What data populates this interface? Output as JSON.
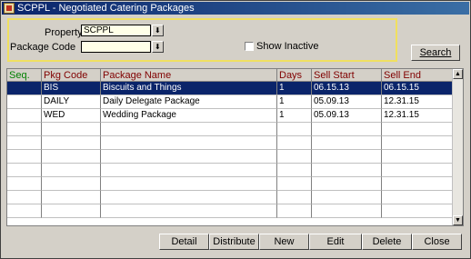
{
  "window": {
    "title": "SCPPL - Negotiated Catering Packages"
  },
  "filters": {
    "property_label": "Property",
    "property_value": "SCPPL",
    "package_code_label": "Package Code",
    "package_code_value": "",
    "show_inactive_label": "Show Inactive",
    "show_inactive_checked": false,
    "search_label": "Search"
  },
  "table": {
    "columns": [
      "Seq.",
      "Pkg Code",
      "Package Name",
      "Days",
      "Sell Start",
      "Sell End"
    ],
    "rows": [
      {
        "seq": "",
        "code": "BIS",
        "name": "Biscuits and Things",
        "days": "1",
        "start": "06.15.13",
        "end": "06.15.15",
        "selected": true
      },
      {
        "seq": "",
        "code": "DAILY",
        "name": "Daily Delegate Package",
        "days": "1",
        "start": "05.09.13",
        "end": "12.31.15",
        "selected": false
      },
      {
        "seq": "",
        "code": "WED",
        "name": "Wedding Package",
        "days": "1",
        "start": "05.09.13",
        "end": "12.31.15",
        "selected": false
      }
    ]
  },
  "buttons": {
    "detail": "Detail",
    "distribute": "Distribute",
    "new": "New",
    "edit": "Edit",
    "delete": "Delete",
    "close": "Close"
  },
  "icons": {
    "dropdown": "dropdown-arrow-icon",
    "app": "app-icon"
  },
  "colors": {
    "selection": "#0a246a",
    "filter_border": "#f0e060",
    "header_text": "#800000",
    "seq_header": "#008000"
  }
}
